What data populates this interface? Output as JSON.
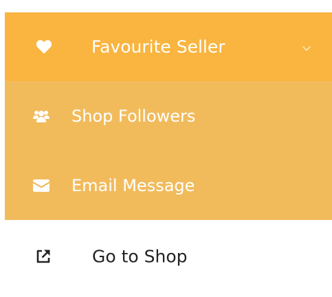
{
  "colors": {
    "header_bg": "#f9b53f",
    "submenu_bg": "#f1bb5c",
    "header_text": "#ffffff",
    "plain_text": "#222222"
  },
  "menu": {
    "header": {
      "label": "Favourite Seller",
      "icon": "heart-icon",
      "expand_icon": "chevron-down-icon"
    },
    "submenu": [
      {
        "label": "Shop Followers",
        "icon": "users-icon"
      },
      {
        "label": "Email Message",
        "icon": "envelope-icon"
      }
    ],
    "links": [
      {
        "label": "Go to Shop",
        "icon": "external-link-icon"
      }
    ]
  }
}
